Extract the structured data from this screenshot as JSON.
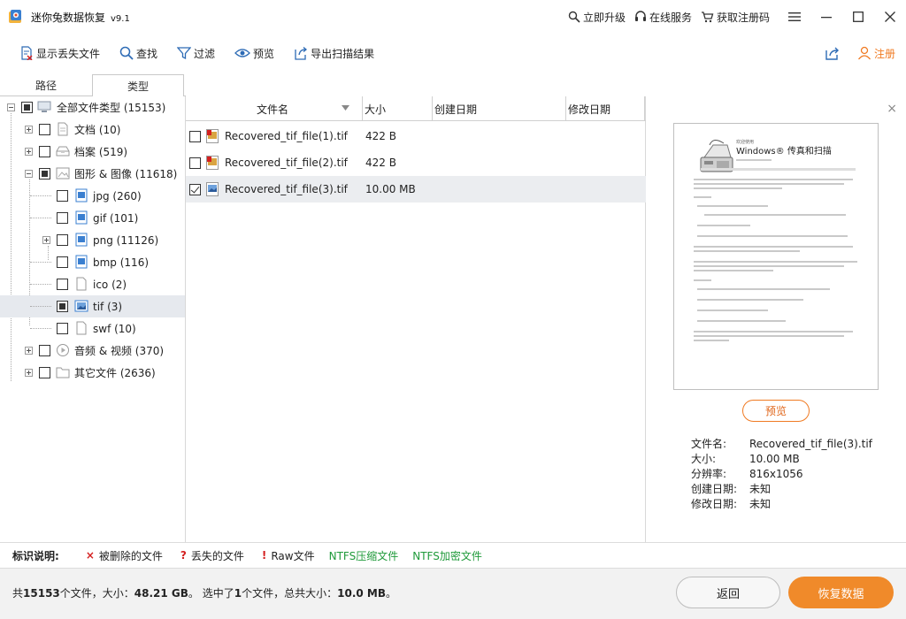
{
  "app": {
    "title": "迷你兔数据恢复",
    "version": "v9.1",
    "upgrade": "立即升级",
    "online_service": "在线服务",
    "get_code": "获取注册码"
  },
  "toolbar": {
    "show_lost": "显示丢失文件",
    "find": "查找",
    "filter": "过滤",
    "preview": "预览",
    "export": "导出扫描结果",
    "register": "注册"
  },
  "tabs": {
    "path": "路径",
    "type": "类型"
  },
  "tree": {
    "root": "全部文件类型 (15153)",
    "doc": "文档 (10)",
    "archive": "档案 (519)",
    "images": "图形 & 图像 (11618)",
    "jpg": "jpg (260)",
    "gif": "gif (101)",
    "png": "png (11126)",
    "bmp": "bmp (116)",
    "ico": "ico (2)",
    "tif": "tif (3)",
    "swf": "swf (10)",
    "audio_video": "音频 & 视频 (370)",
    "other": "其它文件 (2636)"
  },
  "columns": {
    "name": "文件名",
    "size": "大小",
    "created": "创建日期",
    "modified": "修改日期"
  },
  "files": [
    {
      "name": "Recovered_tif_file(1).tif",
      "size": "422 B",
      "checked": false
    },
    {
      "name": "Recovered_tif_file(2).tif",
      "size": "422 B",
      "checked": false
    },
    {
      "name": "Recovered_tif_file(3).tif",
      "size": "10.00 MB",
      "checked": true
    }
  ],
  "preview": {
    "button": "预览",
    "doc_title": "Windows® 传真和扫描",
    "doc_kicker": "欢迎使用",
    "name_label": "文件名:",
    "name_value": "Recovered_tif_file(3).tif",
    "size_label": "大小:",
    "size_value": "10.00 MB",
    "res_label": "分辨率:",
    "res_value": "816x1056",
    "created_label": "创建日期:",
    "created_value": "未知",
    "modified_label": "修改日期:",
    "modified_value": "未知"
  },
  "legend": {
    "title": "标识说明:",
    "deleted": "被删除的文件",
    "lost": "丢失的文件",
    "raw": "Raw文件",
    "ntfs_compressed": "NTFS压缩文件",
    "ntfs_encrypted": "NTFS加密文件",
    "deleted_mark": "×",
    "lost_mark": "?",
    "raw_mark": "!"
  },
  "status": {
    "prefix": "共",
    "total_count": "15153",
    "mid1": "个文件，大小：",
    "total_size": "48.21 GB",
    "mid2": "。 选中了",
    "sel_count": "1",
    "mid3": "个文件，总共大小：",
    "sel_size": "10.0 MB",
    "suffix": "。"
  },
  "buttons": {
    "back": "返回",
    "recover": "恢复数据"
  },
  "colors": {
    "accent": "#f08a2a",
    "ntfs_green": "#1f9a3a",
    "mark_red": "#d42020",
    "selection": "#e6e9ee"
  }
}
